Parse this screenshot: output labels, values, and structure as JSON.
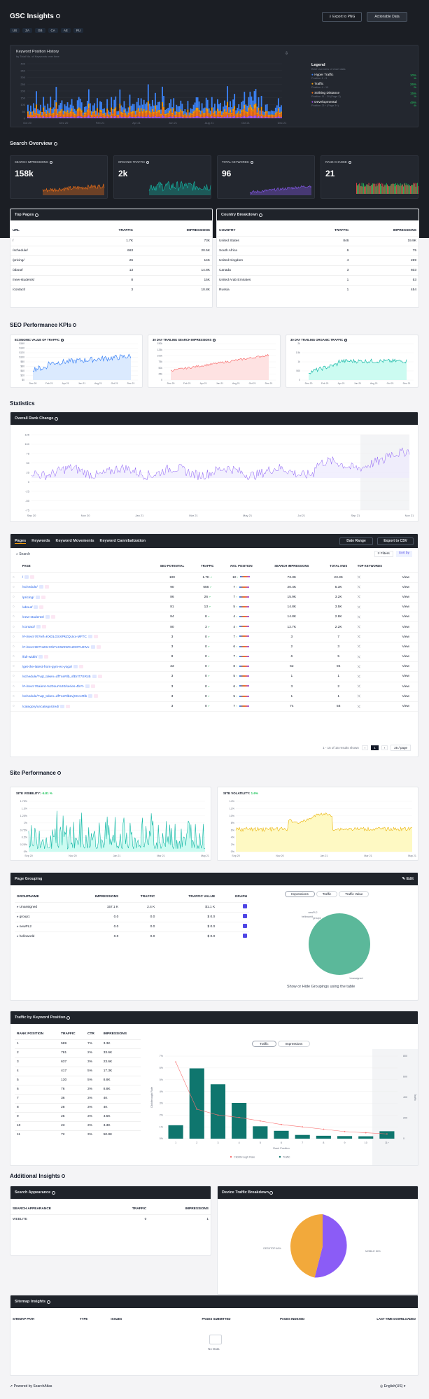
{
  "header": {
    "title": "GSC Insights",
    "export_png": "Export to PNG",
    "actionable": "Actionable Data",
    "countries": [
      "US",
      "ZA",
      "GB",
      "CA",
      "AE",
      "RU"
    ]
  },
  "kph": {
    "title": "Keyword Position History",
    "subtitle": "by Total No. of Keywords over time",
    "yticks": [
      "400",
      "350",
      "300",
      "250",
      "200",
      "150",
      "100",
      "50",
      "0"
    ],
    "xticks": [
      "Oct 20",
      "Dec 20",
      "Feb 21",
      "Apr 21",
      "Jun 21",
      "Aug 21",
      "Oct 21",
      "Dec 21"
    ],
    "legend_title": "Legend",
    "legend_sub": "Brief overview of chart data",
    "legend": [
      {
        "name": "Hyper Traffic",
        "range": "Position 1 - 3",
        "pct": "10%",
        "kw": "1k",
        "color": "#3b82f6"
      },
      {
        "name": "Traffic",
        "range": "Position 4 - 10",
        "pct": "26%",
        "kw": "2k",
        "color": "#f59e0b"
      },
      {
        "name": "Striking Distance",
        "range": "Position 11 - 20 (Page 2)",
        "pct": "15%",
        "kw": "1k",
        "color": "#f97316"
      },
      {
        "name": "Developmental",
        "range": "Position 21+ (Page 3+)",
        "pct": "49%",
        "kw": "4k",
        "color": "#a855f7"
      }
    ]
  },
  "overview": {
    "title": "Search Overview",
    "cards": [
      {
        "label": "SEARCH IMPRESSIONS",
        "value": "158k",
        "color": "#f97316"
      },
      {
        "label": "ORGANIC TRAFFIC",
        "value": "2k",
        "color": "#14b8a6"
      },
      {
        "label": "TOTAL KEYWORDS",
        "value": "96",
        "color": "#8b5cf6"
      },
      {
        "label": "RANK CHANGE",
        "value": "21",
        "color": "#ef4444"
      }
    ]
  },
  "top_pages": {
    "title": "Top Pages",
    "cols": [
      "URL",
      "TRAFFIC",
      "IMPRESSIONS"
    ],
    "rows": [
      [
        "/",
        "1.7K",
        "73K"
      ],
      [
        "/schedule/",
        "663",
        "20.5K"
      ],
      [
        "/pricing/",
        "26",
        "14K"
      ],
      [
        "/about/",
        "13",
        "14.8K"
      ],
      [
        "/new-students/",
        "8",
        "15K"
      ],
      [
        "/contact/",
        "3",
        "10.8K"
      ]
    ]
  },
  "country": {
    "title": "Country Breakdown",
    "cols": [
      "COUNTRY",
      "TRAFFIC",
      "IMPRESSIONS"
    ],
    "rows": [
      [
        "United States",
        "846",
        "19.9K"
      ],
      [
        "South Africa",
        "6",
        "75"
      ],
      [
        "United Kingdom",
        "4",
        "269"
      ],
      [
        "Canada",
        "3",
        "603"
      ],
      [
        "United Arab Emirates",
        "1",
        "53"
      ],
      [
        "Russia",
        "1",
        "454"
      ]
    ]
  },
  "kpis": {
    "title": "SEO Performance KPIs",
    "cards": [
      {
        "label": "ECONOMIC VALUE OF TRAFFIC",
        "color": "#3b82f6",
        "fill": "#dbeafe",
        "yticks": [
          "$160",
          "$140",
          "$120",
          "$100",
          "$80",
          "$60",
          "$40",
          "$20",
          "$0"
        ],
        "xticks": [
          "Dec 20",
          "Feb 21",
          "Apr 21",
          "Jun 21",
          "Aug 21",
          "Oct 21",
          "Dec 21"
        ]
      },
      {
        "label": "30 DAY TRAILING SEARCH IMPRESSIONS",
        "color": "#f87171",
        "fill": "#fee2e2",
        "yticks": [
          "150k",
          "125k",
          "100k",
          "75k",
          "50k",
          "25k",
          "0"
        ],
        "xticks": [
          "Dec 20",
          "Feb 21",
          "Apr 21",
          "Jun 21",
          "Aug 21",
          "Oct 21",
          "Dec 21"
        ]
      },
      {
        "label": "30 DAY TRAILING ORGANIC TRAFFIC",
        "color": "#14b8a6",
        "fill": "#ccfbf1",
        "yticks": [
          "2k",
          "1.5k",
          "1k",
          "500",
          "0"
        ],
        "xticks": [
          "Dec 20",
          "Feb 21",
          "Apr 21",
          "Jun 21",
          "Aug 21",
          "Oct 21",
          "Dec 21"
        ]
      }
    ]
  },
  "statistics": {
    "title": "Statistics",
    "rank_title": "Overall Rank Change",
    "yticks": [
      "125",
      "100",
      "75",
      "50",
      "25",
      "0",
      "-25",
      "-50",
      "-75"
    ],
    "xticks": [
      "Sep 20",
      "Nov 20",
      "Jan 21",
      "Mar 21",
      "May 21",
      "Jul 21",
      "Sep 21",
      "Nov 21"
    ]
  },
  "kwtable": {
    "tabs": [
      "Pages",
      "Keywords",
      "Keyword Movements",
      "Keyword Cannibalization"
    ],
    "date_range": "Date Range",
    "export_csv": "Export to CSV",
    "search": "Search",
    "filters": "Filters",
    "sort": "Sort by",
    "cols": [
      "PAGE",
      "SEO POTENTIAL",
      "TRAFFIC",
      "AVG. POSITION",
      "SEARCH IMPRESSIONS",
      "TOTAL KWS",
      "TOP KEYWORDS",
      ""
    ],
    "rows": [
      [
        "/",
        "100",
        "1.7K",
        "10",
        "73.3K",
        "23.3K"
      ],
      [
        "/schedule/",
        "90",
        "656",
        "7",
        "20.4K",
        "5.3K"
      ],
      [
        "/pricing/",
        "86",
        "26",
        "7",
        "15.9K",
        "3.2K"
      ],
      [
        "/about/",
        "81",
        "13",
        "5",
        "14.8K",
        "3.5K"
      ],
      [
        "/new-students/",
        "84",
        "8",
        "4",
        "14.8K",
        "2.8K"
      ],
      [
        "/contact/",
        "80",
        "3",
        "4",
        "12.7K",
        "2.2K"
      ],
      [
        "/#-/next-76?ref=KXDLGSXPkZQUxx-MFTC",
        "3",
        "0",
        "7",
        "3",
        "7"
      ],
      [
        "/#-/next-98?%20c7zbTxCWEW%20OTU2tVx",
        "3",
        "0",
        "6",
        "2",
        "3"
      ],
      [
        "/full-width/",
        "8",
        "0",
        "7",
        "6",
        "5"
      ],
      [
        "/get-the-latest-from-gym-ex-yoga/",
        "33",
        "0",
        "8",
        "62",
        "94"
      ],
      [
        "/schedule/?vqt_token=dfT4eRlb_sfEnT7SRcB",
        "3",
        "0",
        "5",
        "1",
        "1"
      ],
      [
        "/#-/next-76a/ent-%20our%20/series-4bYt-",
        "3",
        "0",
        "6",
        "3",
        "2"
      ],
      [
        "/schedule/?vqt_token=dfT4eRlb2vjXCccRlb",
        "3",
        "0",
        "5",
        "1",
        "1"
      ],
      [
        "/category/uncategorized/",
        "3",
        "0",
        "7",
        "74",
        "56"
      ]
    ],
    "view": "View",
    "pagination": "1 - 15 of 15 results shown",
    "per_page": "25 / page",
    "page": "1"
  },
  "site_perf": {
    "title": "Site Performance",
    "vis_label": "SITE VISIBILITY",
    "vis_val": "-5.81 %",
    "vol_label": "SITE VOLATILITY",
    "vol_val": "1.6%",
    "vis_yticks": [
      "1.75%",
      "1.5%",
      "1.25%",
      "1%",
      "0.75%",
      "0.5%",
      "0.25%",
      "0%"
    ],
    "vol_yticks": [
      "14%",
      "12%",
      "10%",
      "8%",
      "6%",
      "4%",
      "2%",
      "0%"
    ],
    "xticks": [
      "Sep 20",
      "Nov 20",
      "Jan 21",
      "Mar 21",
      "May 21"
    ]
  },
  "grouping": {
    "title": "Page Grouping",
    "edit": "Edit",
    "cols": [
      "GROUPNAME",
      "IMPRESSIONS",
      "TRAFFIC",
      "TRAFFIC VALUE",
      "GRAPH"
    ],
    "rows": [
      [
        "Unassigned",
        "157.1 K",
        "2.4 K",
        "$1.1 K"
      ],
      [
        "group1",
        "0.0",
        "0.0",
        "$ 0.0"
      ],
      [
        "newPL2",
        "0.0",
        "0.0",
        "$ 0.0"
      ],
      [
        "helloworld",
        "0.0",
        "0.0",
        "$ 0.0"
      ]
    ],
    "tabs": [
      "Impressions",
      "Traffic",
      "Traffic Value"
    ],
    "pie_labels": [
      "newPL2",
      "group1",
      "helloworld",
      "Unassigned"
    ],
    "hint": "Show or Hide Groupings using the table"
  },
  "traffic_pos": {
    "title": "Traffic by Keyword Position",
    "cols": [
      "RANK POSITION",
      "TRAFFIC",
      "CTR",
      "IMPRESSIONS"
    ],
    "rows": [
      [
        "1",
        "589",
        "7%",
        "3.3K"
      ],
      [
        "2",
        "781",
        "2%",
        "33.6K"
      ],
      [
        "3",
        "637",
        "3%",
        "23.6K"
      ],
      [
        "4",
        "417",
        "5%",
        "17.3K"
      ],
      [
        "5",
        "130",
        "5%",
        "8.8K"
      ],
      [
        "6",
        "76",
        "3%",
        "8.8K"
      ],
      [
        "7",
        "36",
        "3%",
        "4K"
      ],
      [
        "8",
        "28",
        "3%",
        "4K"
      ],
      [
        "9",
        "25",
        "3%",
        "4.5K"
      ],
      [
        "10",
        "23",
        "3%",
        "3.3K"
      ],
      [
        "11",
        "72",
        "3%",
        "50.8K"
      ]
    ],
    "tabs": [
      "Traffic",
      "Impressions"
    ],
    "yticks_left": [
      "7%",
      "6%",
      "5%",
      "4%",
      "3%",
      "2%",
      "1%",
      "0%"
    ],
    "yticks_right": [
      "800",
      "600",
      "400",
      "200",
      "0"
    ],
    "xlabel": "Rank Position",
    "ylabel_left": "Clickthrough Rate",
    "ylabel_right": "Traffic",
    "legend": [
      "Clickthrough Rate",
      "Traffic"
    ]
  },
  "chart_data": {
    "type": "bar",
    "categories": [
      "1",
      "2",
      "3",
      "4",
      "5",
      "6",
      "7",
      "8",
      "9",
      "10",
      "11+"
    ],
    "series": [
      {
        "name": "Traffic",
        "values": [
          130,
          681,
          527,
          346,
          120,
          76,
          36,
          28,
          25,
          23,
          72
        ]
      },
      {
        "name": "Clickthrough Rate",
        "values": [
          6.5,
          2.5,
          2,
          1.8,
          1.5,
          1.2,
          1,
          0.8,
          0.6,
          0.5,
          0.4
        ]
      }
    ],
    "xlabel": "Rank Position",
    "ylabel": "Traffic",
    "ylim": [
      0,
      800
    ]
  },
  "additional": {
    "title": "Additional Insights",
    "appearance_title": "Search Appearance",
    "app_cols": [
      "SEARCH APPEARANCE",
      "TRAFFIC",
      "IMPRESSIONS"
    ],
    "app_rows": [
      [
        "WEBLITE",
        "0",
        "1"
      ]
    ],
    "device_title": "Device Traffic Breakdown",
    "device_labels": [
      "DESKTOP 46%",
      "MOBILE 54%"
    ]
  },
  "sitemap": {
    "title": "Sitemap Insights",
    "cols": [
      "SITEMAP PATH",
      "TYPE",
      "ISSUES",
      "PAGES SUBMITTED",
      "PAGES INDEXED",
      "LAST TIME DOWNLOADED"
    ],
    "empty": "No Data"
  },
  "footer": {
    "powered": "Powered by SearchAtlas",
    "lang": "English(US)"
  }
}
